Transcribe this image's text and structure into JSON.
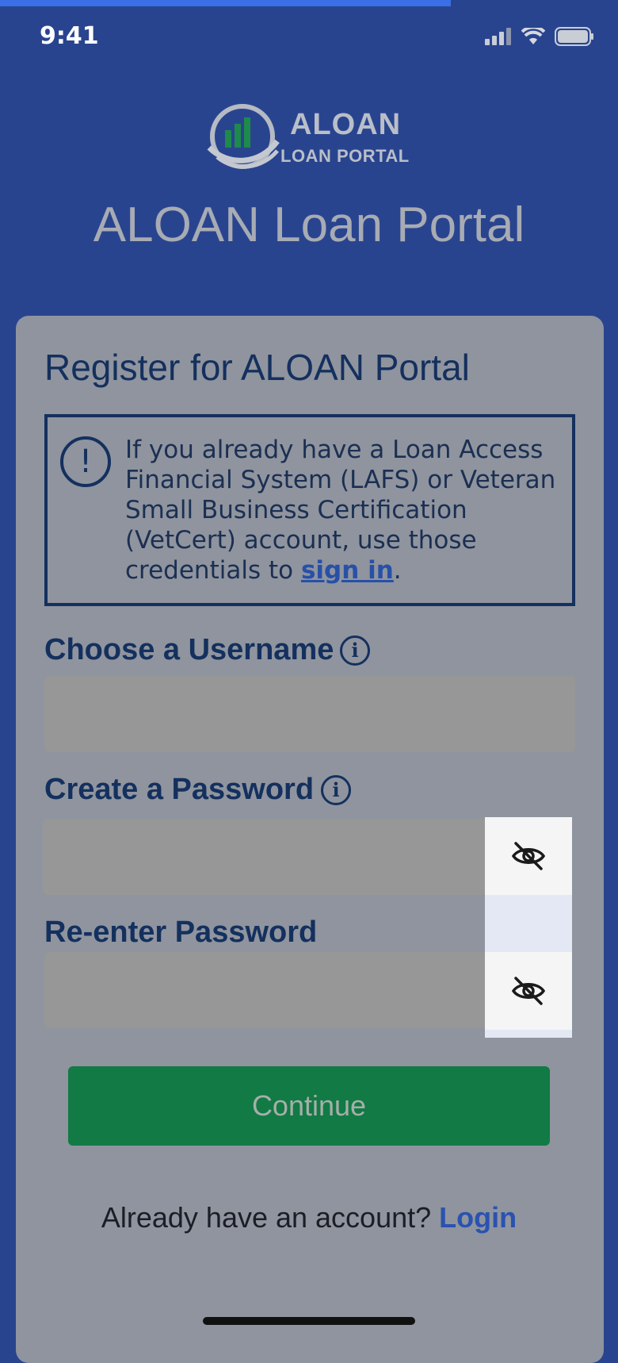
{
  "progress": {
    "fraction": 0.73
  },
  "status_bar": {
    "time": "9:41"
  },
  "logo": {
    "name": "ALOAN",
    "tagline": "LOAN PORTAL"
  },
  "header": {
    "title": "ALOAN Loan Portal"
  },
  "form": {
    "title": "Register for ALOAN Portal",
    "alert": {
      "text_before_link": "If you already have a Loan Access Financial System (LAFS) or Veteran Small Business Certification (VetCert) account, use those credentials to ",
      "link_label": "sign in",
      "text_after_link": "."
    },
    "username": {
      "label": "Choose a Username",
      "value": "",
      "placeholder": ""
    },
    "password": {
      "label": "Create a Password",
      "value": "",
      "placeholder": ""
    },
    "confirm_password": {
      "label": "Re-enter Password",
      "value": "",
      "placeholder": ""
    },
    "continue_label": "Continue",
    "login_prompt": "Already have an account?",
    "login_label": "Login"
  },
  "colors": {
    "background": "#29448f",
    "card": "#8f949e",
    "primary_text": "#14305e",
    "button": "#127a45",
    "link": "#2a52b0",
    "progress": "#3a6fe6"
  },
  "icons": {
    "alert": "exclamation-circle-icon",
    "info": "info-circle-icon",
    "password_toggle": "eye-slash-icon",
    "signal": "cellular-signal-icon",
    "wifi": "wifi-icon",
    "battery": "battery-icon"
  }
}
